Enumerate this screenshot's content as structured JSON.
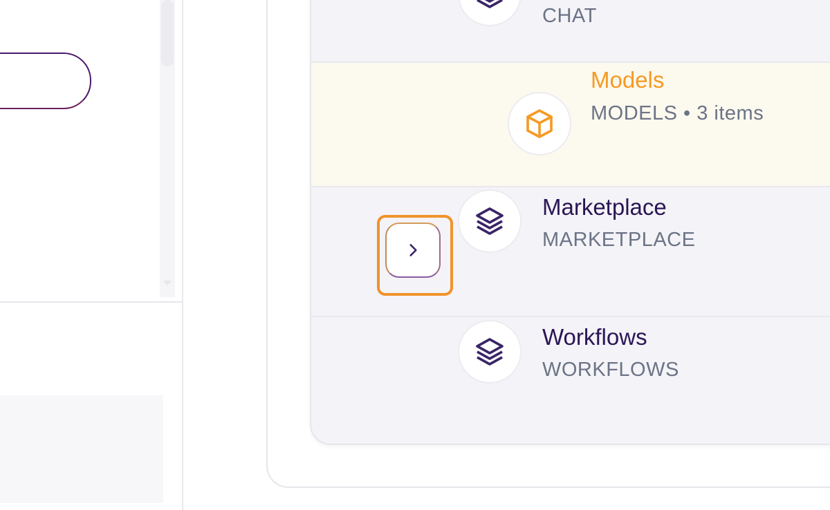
{
  "tree": {
    "nodes": [
      {
        "title": "",
        "subtitle": "CHAT",
        "icon": "layers-icon"
      },
      {
        "title": "Models",
        "subtitle": "MODELS • 3 items",
        "icon": "cube-icon",
        "selected": true
      },
      {
        "title": "Marketplace",
        "subtitle": "MARKETPLACE",
        "icon": "layers-icon",
        "expandable": true
      },
      {
        "title": "Workflows",
        "subtitle": "WORKFLOWS",
        "icon": "layers-icon"
      }
    ]
  },
  "colors": {
    "accent_orange": "#f59a23",
    "title_purple": "#2a1655",
    "subtitle_gray": "#6b7386",
    "selected_row_bg": "#fcf9ee",
    "focus_ring": "#f0932b"
  }
}
